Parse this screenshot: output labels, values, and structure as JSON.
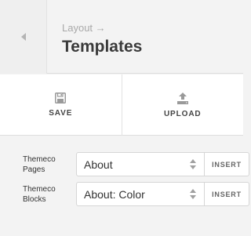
{
  "header": {
    "back_icon": "chevron-left-icon",
    "breadcrumb": "Layout →",
    "title": "Templates"
  },
  "actions": [
    {
      "label": "SAVE",
      "icon": "save-icon"
    },
    {
      "label": "UPLOAD",
      "icon": "upload-icon"
    }
  ],
  "rows": [
    {
      "label": "Themeco Pages",
      "selected": "About",
      "button": "INSERT"
    },
    {
      "label": "Themeco Blocks",
      "selected": "About: Color",
      "button": "INSERT"
    }
  ],
  "colors": {
    "background": "#f3f3f3",
    "panel_white": "#ffffff",
    "border": "#dedede",
    "title_text": "#3a3a3a",
    "muted_text": "#a9a9a9",
    "icon_gray": "#9a9a9a"
  }
}
